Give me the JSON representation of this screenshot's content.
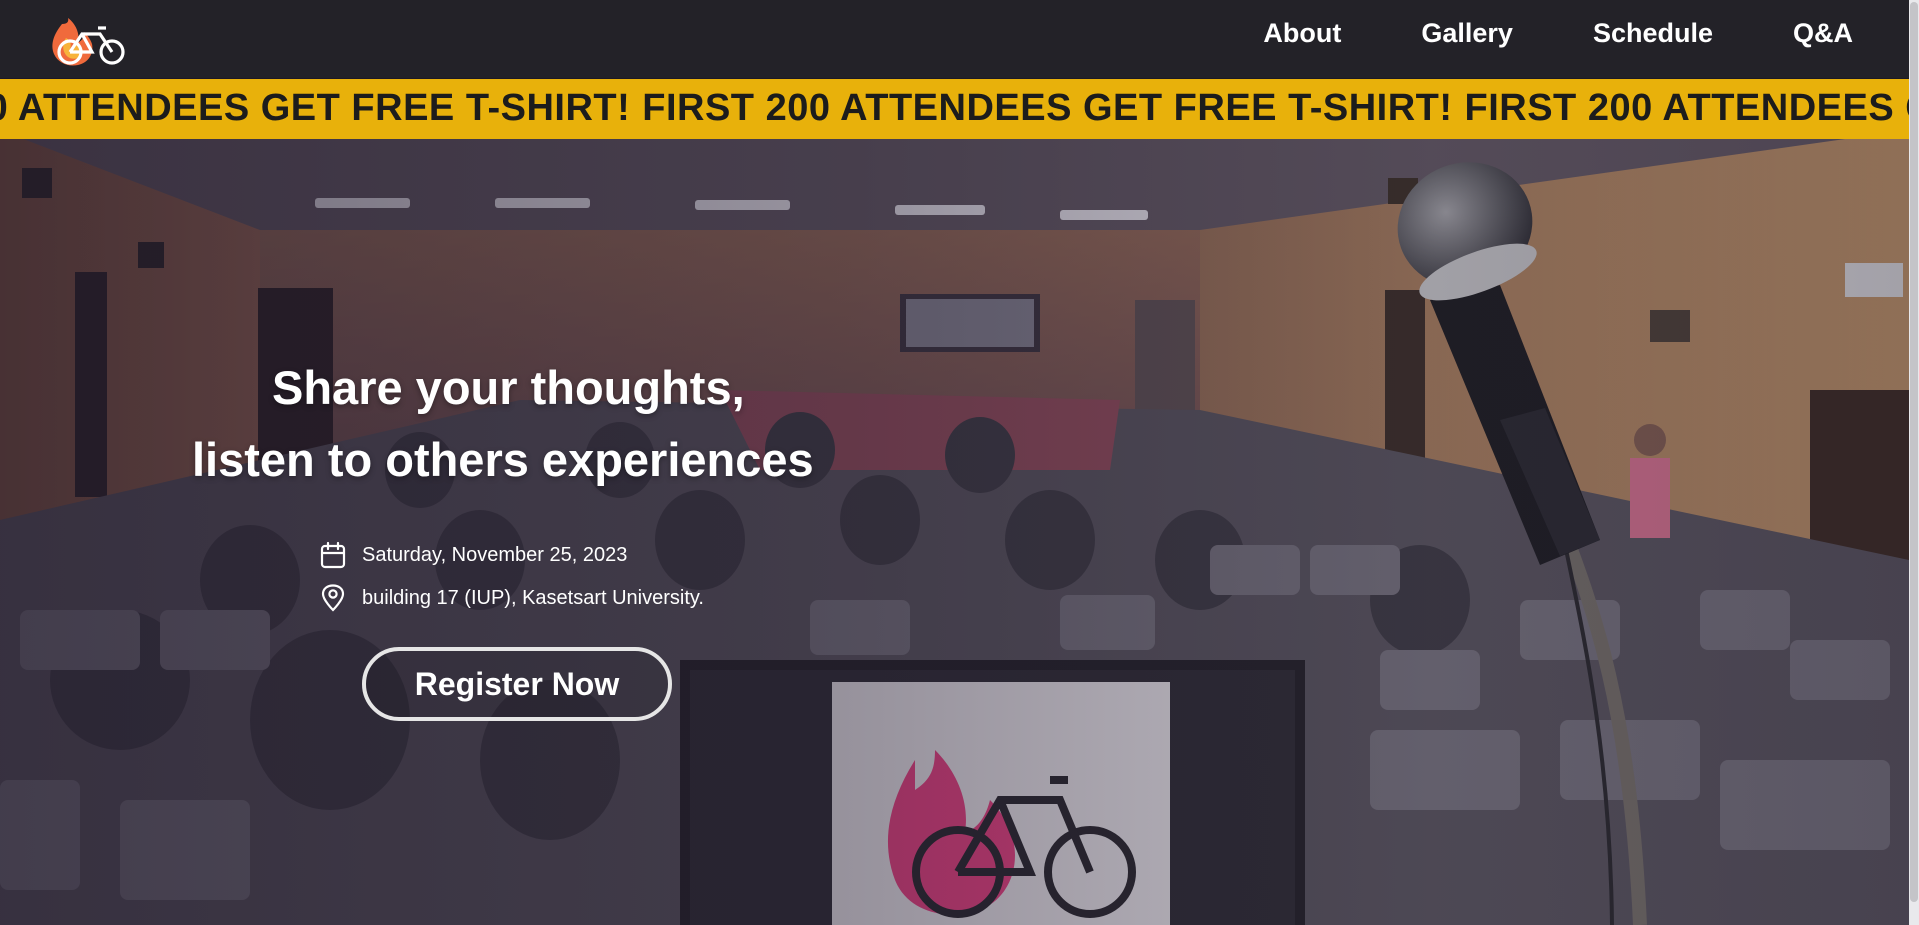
{
  "navbar": {
    "logo_icon": "flame-bicycle-logo-icon",
    "links": [
      {
        "label": "About"
      },
      {
        "label": "Gallery"
      },
      {
        "label": "Schedule"
      },
      {
        "label": "Q&A"
      }
    ]
  },
  "marquee": {
    "text": "FIRST 200 ATTENDEES GET FREE T-SHIRT!"
  },
  "hero": {
    "headline_line1": "Share your thoughts,",
    "headline_line2": "listen to others experiences",
    "date_icon": "calendar-icon",
    "date": "Saturday, November 25, 2023",
    "location_icon": "map-pin-icon",
    "location": "building 17 (IUP), Kasetsart University.",
    "register_label": "Register Now"
  },
  "colors": {
    "navbar_bg": "#232228",
    "marquee_bg": "#e8b10b",
    "marquee_text": "#1c1c1c",
    "logo_flame": "#f06a3c",
    "screen_logo": "#d9407d"
  }
}
